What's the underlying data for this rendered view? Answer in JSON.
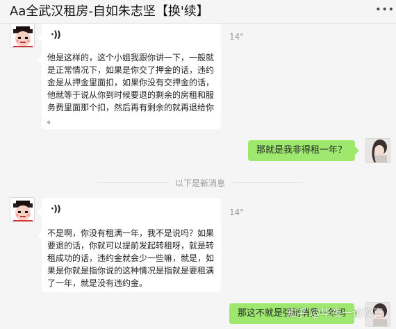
{
  "window": {
    "title": "Aa全武汉租房-自如朱志坚【换'续】",
    "more_icon": "more-dots-icon"
  },
  "messages": [
    {
      "type": "voice",
      "side": "left",
      "voice_glyph": "·))",
      "duration": "14\"",
      "transcript": "他是这样的，这个小姐我跟你讲一下，一般就\n是正常情况下，如果是你交了押金的话，违约\n金是从押金里面扣，如果你没有交押金的话，\n他就等于说从你到时候要退的剩余的房租和服\n务费里面那个扣，然后再有剩余的就再退给你\n。"
    },
    {
      "type": "text",
      "side": "right",
      "text": "那就是我非得租一年？"
    },
    {
      "type": "divider",
      "text": "以下是新消息"
    },
    {
      "type": "voice",
      "side": "left",
      "voice_glyph": "·))",
      "duration": "14\"",
      "transcript": "不是啊，你没有租满一年，我不是说吗？如果\n要退的话，你就可以提前发起转租呀，就是转\n租成功的话，违约金就会少一些嘛，就是，如\n果是你就是指你说的这种情况是指就是要租满\n了一年，就是没有违约金。"
    },
    {
      "type": "text",
      "side": "right",
      "text": "那这不就是强制消费一年吗"
    }
  ],
  "watermark": "知乎 @毕夜一访欢喜",
  "colors": {
    "background": "#f5f5f5",
    "own_bubble": "#9ee870",
    "other_bubble": "#ffffff",
    "meta_text": "#999999"
  }
}
